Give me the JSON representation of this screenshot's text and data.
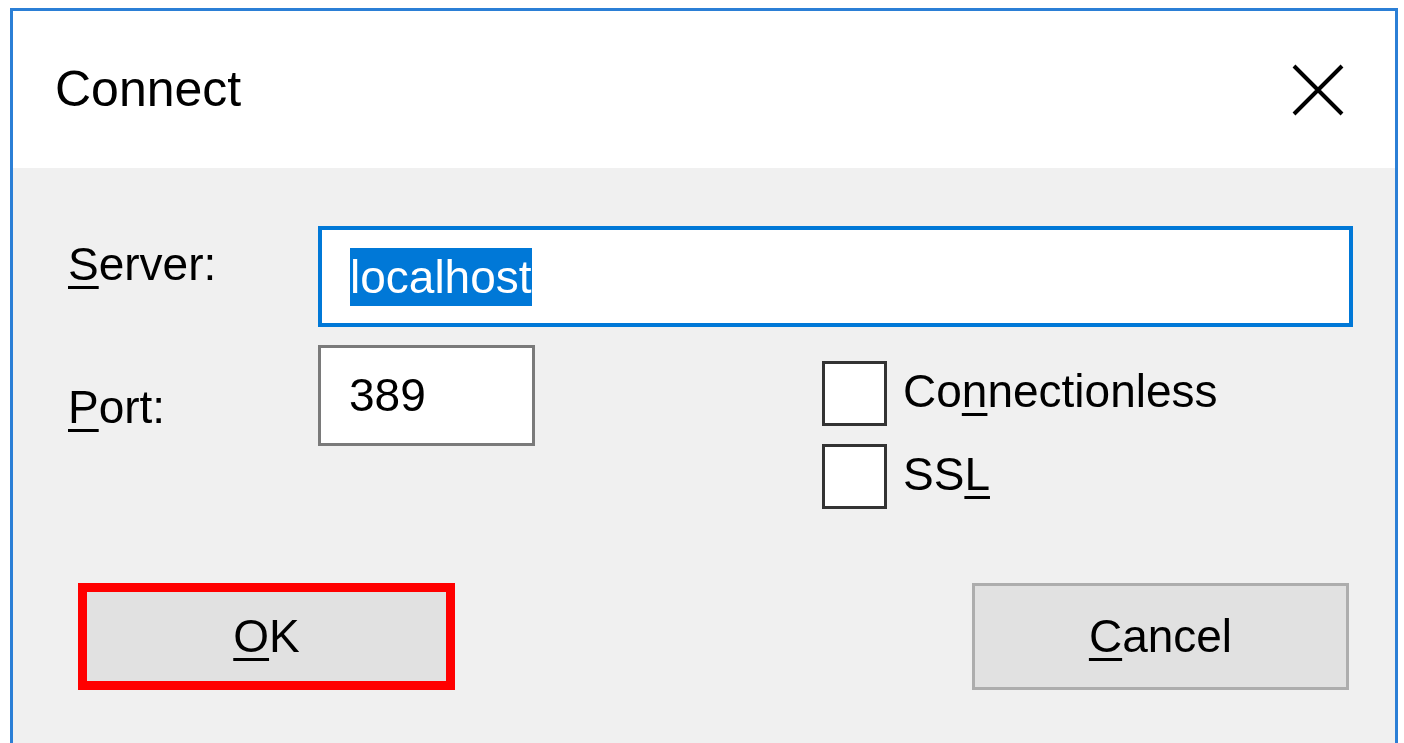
{
  "window": {
    "title": "Connect"
  },
  "server": {
    "label": [
      {
        "text": "S",
        "underlined": true
      },
      {
        "text": "erver:",
        "underlined": false
      }
    ],
    "value": "localhost",
    "focused": true,
    "text_selected": true
  },
  "port": {
    "label": [
      {
        "text": "P",
        "underlined": true
      },
      {
        "text": "ort:",
        "underlined": false
      }
    ],
    "value": "389",
    "focused": false,
    "text_selected": false
  },
  "options": [
    {
      "label": [
        {
          "text": "Co",
          "underlined": false
        },
        {
          "text": "n",
          "underlined": true
        },
        {
          "text": "nectionless",
          "underlined": false
        }
      ],
      "checked": false
    },
    {
      "label": [
        {
          "text": "SS",
          "underlined": false
        },
        {
          "text": "L",
          "underlined": true
        }
      ],
      "checked": false
    }
  ],
  "buttons": [
    {
      "label": [
        {
          "text": "O",
          "underlined": true
        },
        {
          "text": "K",
          "underlined": false
        }
      ],
      "highlighted": true
    },
    {
      "label": [
        {
          "text": "C",
          "underlined": true
        },
        {
          "text": "ancel",
          "underlined": false
        }
      ],
      "highlighted": false
    }
  ]
}
